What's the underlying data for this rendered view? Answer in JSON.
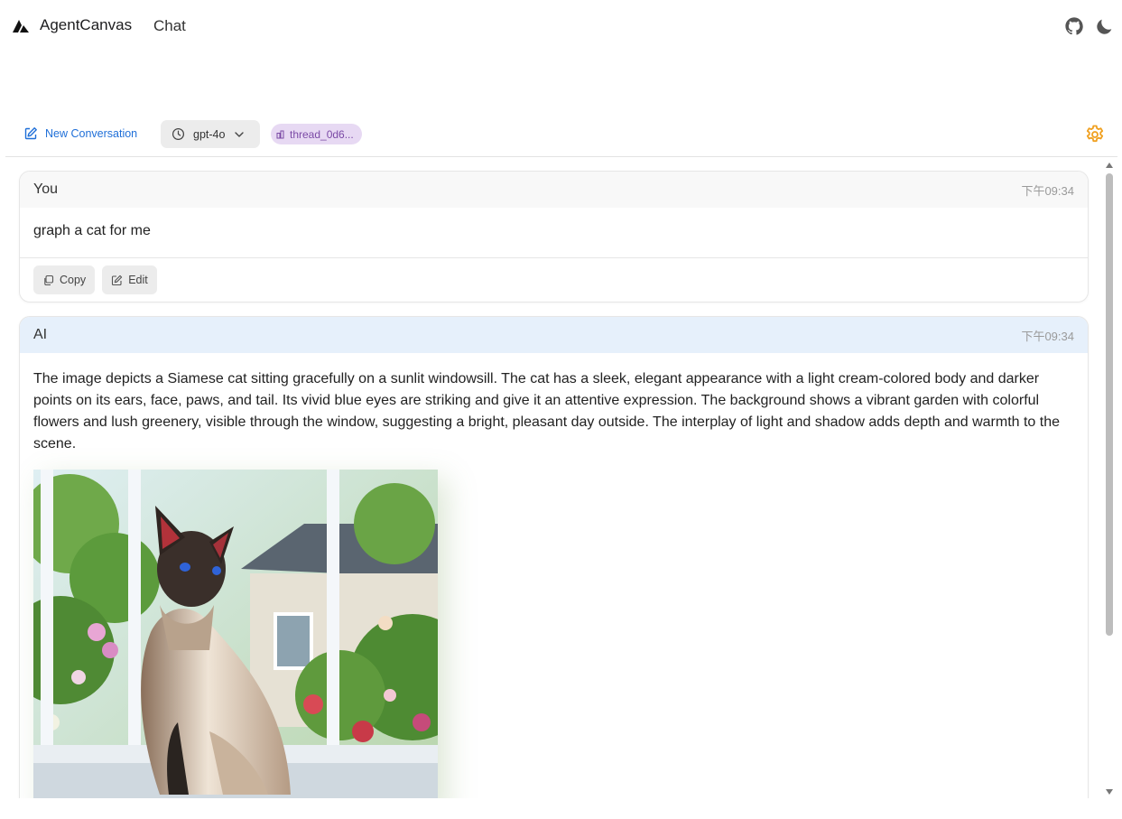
{
  "app": {
    "brand": "AgentCanvas",
    "nav_chat": "Chat"
  },
  "toolbar": {
    "new_conversation": "New Conversation",
    "model": "gpt-4o",
    "thread": "thread_0d6..."
  },
  "messages": {
    "user": {
      "author": "You",
      "time": "下午09:34",
      "text": "graph a cat for me",
      "copy_label": "Copy",
      "edit_label": "Edit"
    },
    "ai": {
      "author": "AI",
      "time": "下午09:34",
      "text": "The image depicts a Siamese cat sitting gracefully on a sunlit windowsill. The cat has a sleek, elegant appearance with a light cream-colored body and darker points on its ears, face, paws, and tail. Its vivid blue eyes are striking and give it an attentive expression. The background shows a vibrant garden with colorful flowers and lush greenery, visible through the window, suggesting a bright, pleasant day outside. The interplay of light and shadow adds depth and warmth to the scene."
    }
  },
  "icons": {
    "logo": "agentcanvas-logo-icon",
    "github": "github-icon",
    "theme": "moon-icon",
    "settings": "gear-icon",
    "new_conversation": "edit-square-icon",
    "model": "clock-icon",
    "thread": "thread-icon",
    "copy": "copy-icon",
    "edit": "edit-icon"
  },
  "colors": {
    "accent_blue": "#1f6fd8",
    "settings_orange": "#f0a020",
    "thread_badge_bg": "#e7d9f3",
    "ai_header_bg": "#e6f0fb"
  }
}
